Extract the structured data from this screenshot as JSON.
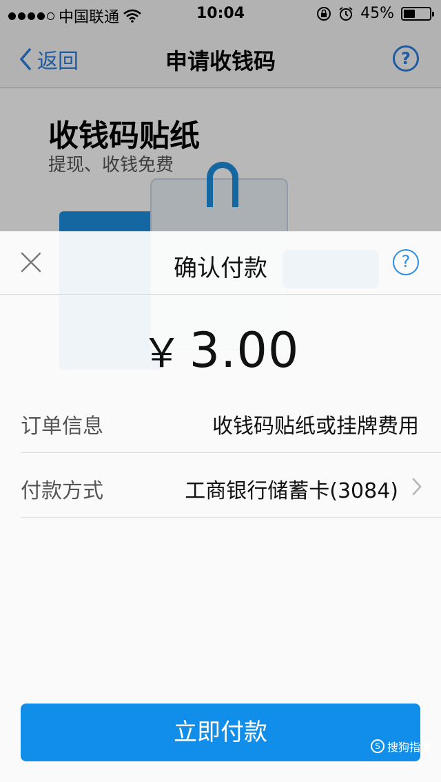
{
  "status_bar": {
    "carrier": "中国联通",
    "time": "10:04",
    "battery_percent": "45%",
    "battery_level": 0.45
  },
  "nav": {
    "back_label": "返回",
    "title": "申请收钱码",
    "help_icon": "?"
  },
  "background": {
    "sticker_title": "收钱码贴纸",
    "sticker_subtitle": "提现、收钱免费"
  },
  "sheet": {
    "title": "确认付款",
    "help_icon": "?",
    "currency_symbol": "￥",
    "amount": "3.00",
    "order_info_label": "订单信息",
    "order_info_value": "收钱码贴纸或挂牌费用",
    "payment_method_label": "付款方式",
    "payment_method_value": "工商银行储蓄卡(3084)",
    "pay_button_label": "立即付款"
  },
  "watermark": {
    "text": "搜狗指南"
  },
  "icons": {
    "close": "close-icon",
    "chevron": "chevron-right-icon",
    "back": "chevron-left-icon",
    "wifi": "wifi-icon",
    "lock": "orientation-lock-icon",
    "alarm": "alarm-icon"
  },
  "colors": {
    "accent": "#108ee9",
    "link_blue": "#2b7fe0"
  }
}
